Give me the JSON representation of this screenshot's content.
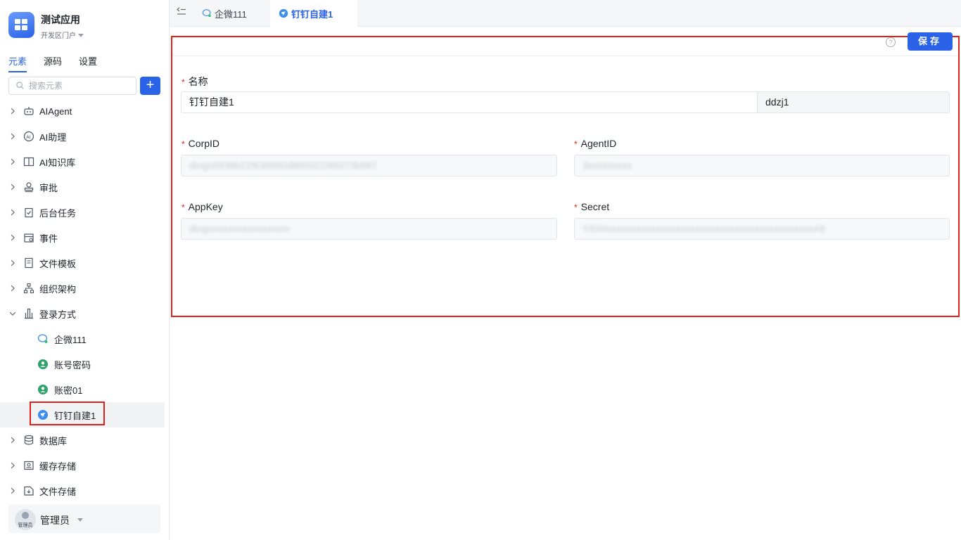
{
  "app": {
    "title": "测试应用",
    "subtitle": "开发区门户"
  },
  "side_tabs": [
    "元素",
    "源码",
    "设置"
  ],
  "search": {
    "placeholder": "搜索元素",
    "add_label": "+"
  },
  "tree": {
    "items": [
      {
        "label": "AIAgent",
        "icon": "robot-icon"
      },
      {
        "label": "AI助理",
        "icon": "ai-assistant-icon"
      },
      {
        "label": "AI知识库",
        "icon": "book-icon"
      },
      {
        "label": "审批",
        "icon": "stamp-icon"
      },
      {
        "label": "后台任务",
        "icon": "clipboard-check-icon"
      },
      {
        "label": "事件",
        "icon": "calendar-icon"
      },
      {
        "label": "文件模板",
        "icon": "document-icon"
      },
      {
        "label": "组织架构",
        "icon": "org-chart-icon"
      },
      {
        "label": "登录方式",
        "icon": "bank-icon"
      }
    ],
    "login_children": [
      {
        "label": "企微111",
        "icon": "wecom-icon"
      },
      {
        "label": "账号密码",
        "icon": "user-circle-icon"
      },
      {
        "label": "账密01",
        "icon": "user-circle-icon"
      },
      {
        "label": "钉钉自建1",
        "icon": "dingtalk-icon"
      }
    ],
    "bottom_items": [
      {
        "label": "数据库",
        "icon": "database-icon"
      },
      {
        "label": "缓存存储",
        "icon": "cache-icon"
      },
      {
        "label": "文件存储",
        "icon": "file-storage-icon"
      }
    ]
  },
  "user": {
    "name": "管理员",
    "avatar_tag": "管理员"
  },
  "tabs": [
    {
      "label": "企微111",
      "active": false
    },
    {
      "label": "钉钉自建1",
      "active": true
    }
  ],
  "toolbar": {
    "help": "?",
    "save_label": "保存"
  },
  "form": {
    "name_label": "名称",
    "name_value": "钉钉自建1",
    "code_value": "ddzj1",
    "corpid_label": "CorpID",
    "corpid_value": "dingc0938b21f636680d885021f46373b687",
    "agentid_label": "AgentID",
    "agentid_value": "3xxxxxxxxx",
    "appkey_label": "AppKey",
    "appkey_value": "dingxxxxxxxxxxxxxxxm",
    "secret_label": "Secret",
    "secret_value": "YtGHxxxxxxxxxxxxxxxxxxxxxxxxxxxxxxxxxxxxxxxxxxAlt"
  },
  "colors": {
    "accent": "#2b63e8",
    "required": "#e0221a",
    "highlight": "#e0221a"
  }
}
